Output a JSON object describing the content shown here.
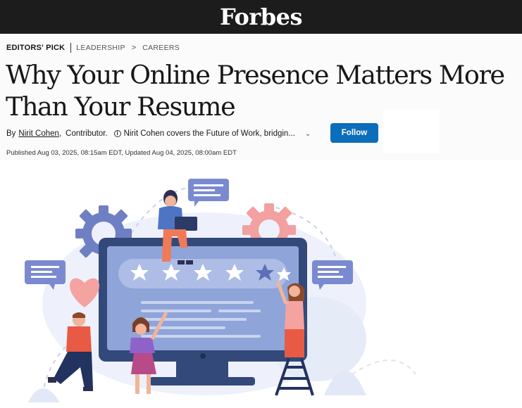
{
  "brand": {
    "logo": "Forbes"
  },
  "breadcrumb": {
    "pick": "EDITORS' PICK",
    "section": "LEADERSHIP",
    "subsection": "CAREERS",
    "separator": ">"
  },
  "article": {
    "title": "Why Your Online Presence Matters More Than Your Resume",
    "by_label": "By",
    "author": "Nirit Cohen",
    "role": "Contributor.",
    "author_bio": "Nirit Cohen covers the Future of Work, bridgin...",
    "follow_label": "Follow",
    "published": "Published Aug 03, 2025, 08:15am EDT, Updated Aug 04, 2025, 08:00am EDT"
  },
  "icons": {
    "info": "info-icon",
    "expand": "chevron-down-icon",
    "breadcrumb_sep": "chevron-right-icon"
  },
  "illustration": {
    "rating": {
      "value": 4,
      "max": 5
    },
    "colors": {
      "accent_blue": "#0c6dbb",
      "monitor_frame": "#33497a",
      "screen": "#8fa4d9",
      "gear_blue": "#6f7fc4",
      "gear_pink": "#f2a0a0"
    }
  }
}
